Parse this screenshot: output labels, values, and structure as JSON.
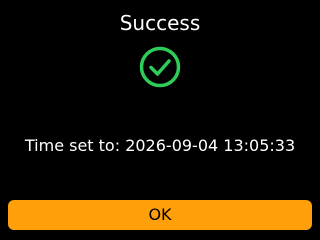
{
  "dialog": {
    "title": "Success",
    "icon": "check-circle-icon",
    "message": "Time set to: 2026-09-04 13:05:33",
    "ok_label": "OK"
  },
  "colors": {
    "background": "#000000",
    "text": "#ffffff",
    "success": "#2ecc58",
    "button": "#ff9f0a",
    "button_text": "#000000"
  }
}
